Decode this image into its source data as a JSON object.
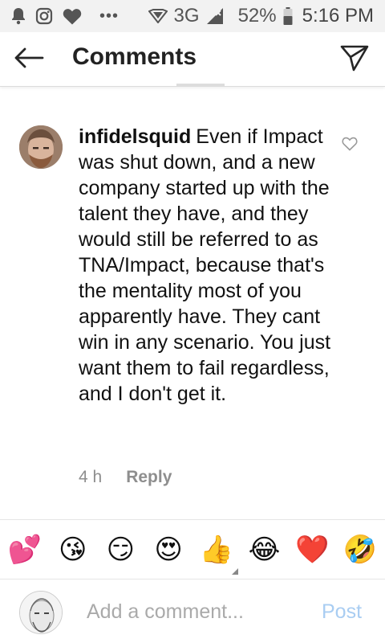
{
  "status_bar": {
    "network": "3G",
    "battery": "52%",
    "time": "5:16 PM",
    "icons": [
      "notification-bell-icon",
      "instagram-icon",
      "heart-icon",
      "more-dots-icon",
      "data-saver-icon",
      "signal-icon",
      "battery-icon"
    ]
  },
  "header": {
    "title": "Comments",
    "back_icon": "arrow-left-icon",
    "send_icon": "paper-plane-icon"
  },
  "comment": {
    "username": "infidelsquid",
    "text": "Even if Impact was shut down, and a new company started up with the talent they have, and they would still be referred to as TNA/Impact, because that's the mentality most of you apparently have. They cant win in any scenario. You just want them to fail regardless, and I don't get it.",
    "time": "4 h",
    "reply_label": "Reply"
  },
  "emoji_bar": {
    "emojis": [
      "💕",
      "😘",
      "😏",
      "😍",
      "👍",
      "😂",
      "❤️",
      "🤣"
    ]
  },
  "input": {
    "placeholder": "Add a comment...",
    "post_label": "Post"
  },
  "colors": {
    "post_disabled": "#a9cdf2",
    "meta_gray": "#8e8e8e"
  }
}
